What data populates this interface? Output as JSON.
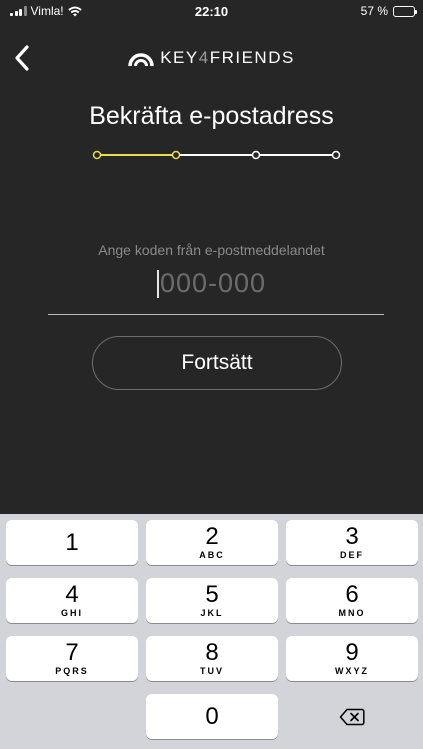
{
  "status_bar": {
    "carrier": "Vimla!",
    "time": "22:10",
    "battery": "57 %",
    "battery_level": 0.57
  },
  "nav": {
    "logo_text_1": "KEY",
    "logo_text_2": "4",
    "logo_text_3": "FRIENDS"
  },
  "page": {
    "title": "Bekräfta e-postadress",
    "progress_steps": 4,
    "current_step": 2
  },
  "code": {
    "label": "Ange koden från e-postmeddelandet",
    "placeholder": "000-000"
  },
  "continue_label": "Fortsätt",
  "keypad": {
    "keys": [
      {
        "num": "1",
        "letters": ""
      },
      {
        "num": "2",
        "letters": "ABC"
      },
      {
        "num": "3",
        "letters": "DEF"
      },
      {
        "num": "4",
        "letters": "GHI"
      },
      {
        "num": "5",
        "letters": "JKL"
      },
      {
        "num": "6",
        "letters": "MNO"
      },
      {
        "num": "7",
        "letters": "PQRS"
      },
      {
        "num": "8",
        "letters": "TUV"
      },
      {
        "num": "9",
        "letters": "WXYZ"
      },
      {
        "num": "0",
        "letters": ""
      }
    ]
  },
  "colors": {
    "background": "#262626",
    "accent": "#e8df4a",
    "keypad_bg": "#d2d4d9"
  }
}
